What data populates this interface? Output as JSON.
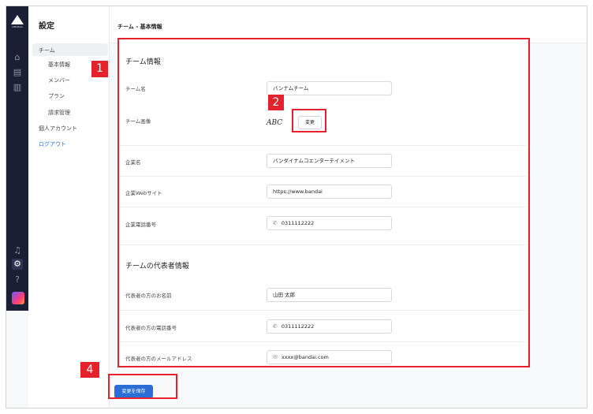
{
  "rail": {
    "logo_text": "infinitum",
    "icons": [
      "home-icon",
      "calendar-icon",
      "chart-icon",
      "bell-icon",
      "gear-icon",
      "help-icon",
      "app-icon"
    ]
  },
  "sidebar": {
    "title": "設定",
    "team": "チーム",
    "basic": "基本情報",
    "members": "メンバー",
    "plan": "プラン",
    "billing": "請求管理",
    "personal": "個人アカウント",
    "logout": "ログアウト"
  },
  "header": {
    "breadcrumb": "チーム - 基本情報"
  },
  "team_info": {
    "title": "チーム情報",
    "team_name_label": "チーム名",
    "team_name_value": "バンナムチーム",
    "team_image_label": "チーム画像",
    "team_image_text": "ABC",
    "change_label": "変更",
    "company_label": "企業名",
    "company_value": "バンダイナムコエンターテイメント",
    "website_label": "企業Webサイト",
    "website_value": "https://www.bandai",
    "phone_label": "企業電話番号",
    "phone_value": "0311112222"
  },
  "rep_info": {
    "title": "チームの代表者情報",
    "name_label": "代表者の方のお名前",
    "name_value": "山田 太郎",
    "phone_label": "代表者の方の電話番号",
    "phone_value": "0311112222",
    "email_label": "代表者の方のメールアドレス",
    "email_value": "xxxx@bandai.com"
  },
  "save_label": "変更を保存",
  "annotations": {
    "a1": "1",
    "a2": "2",
    "a4": "4"
  },
  "colors": {
    "accent": "#2b6fd6",
    "rail": "#1a1f36",
    "annotation": "#e3222b"
  }
}
